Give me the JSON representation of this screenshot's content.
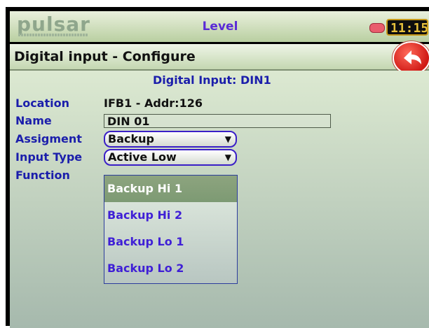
{
  "topbar": {
    "logo_text": "pulsar",
    "title": "Level",
    "clock": "11:15"
  },
  "header": {
    "title": "Digital input - Configure"
  },
  "content": {
    "section_title": "Digital Input: DIN1",
    "location_label": "Location",
    "location_value": "IFB1 - Addr:126",
    "name_label": "Name",
    "name_value": "DIN 01",
    "assignment_label": "Assigment",
    "assignment_value": "Backup",
    "input_type_label": "Input Type",
    "input_type_value": "Active Low",
    "function_label": "Function",
    "function_options": [
      "Backup Hi 1",
      "Backup Hi 2",
      "Backup Lo 1",
      "Backup Lo 2"
    ],
    "function_selected_index": 0
  },
  "icons": {
    "back": "back-arrow-icon",
    "dropdown": "chevron-down-icon",
    "status": "status-led-icon"
  },
  "colors": {
    "label": "#1b1eab",
    "option": "#3f1fd6",
    "selected_option_bg": "#8da47f",
    "back_button": "#d01a16",
    "clock_fg": "#e8c23b"
  }
}
